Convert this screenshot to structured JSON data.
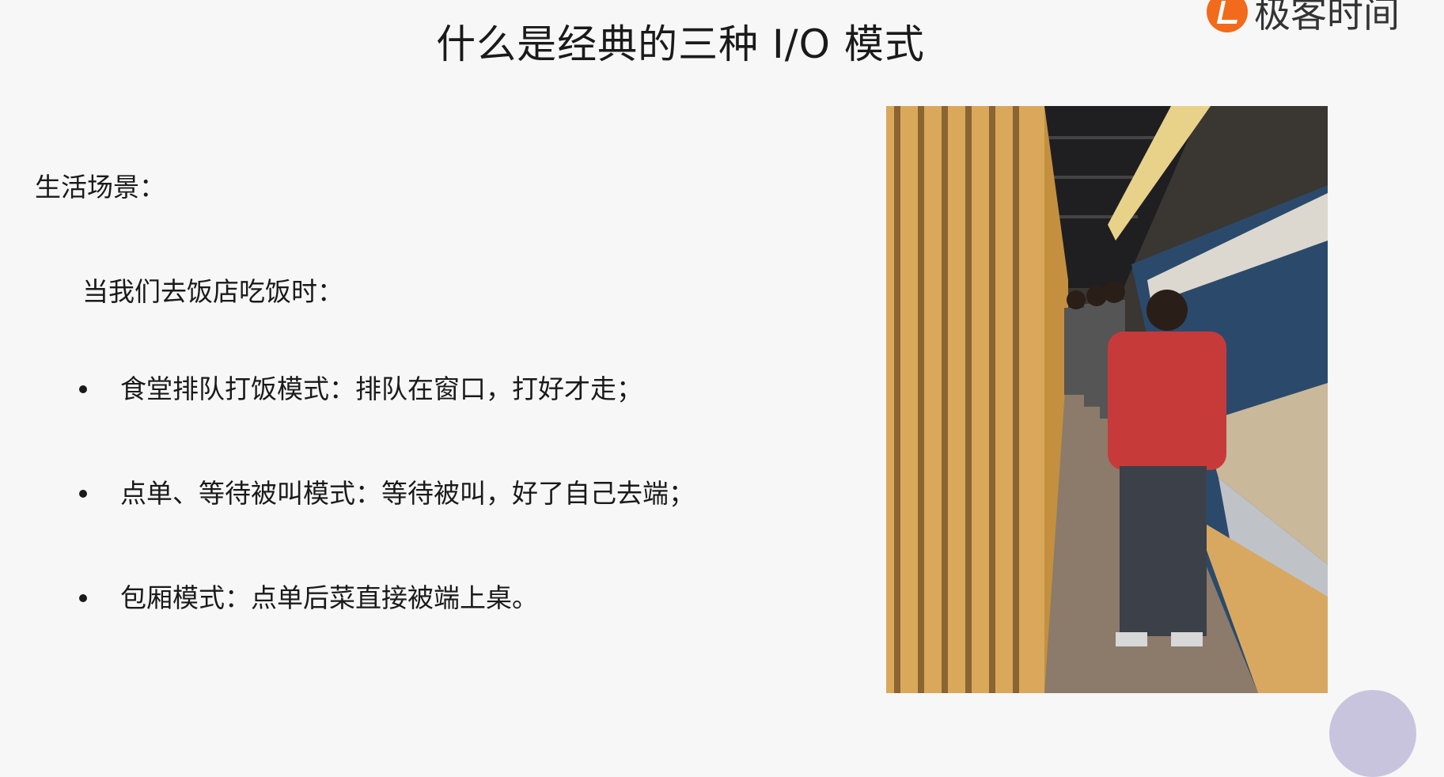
{
  "slide": {
    "title": "什么是经典的三种 I/O 模式",
    "logo_text": "极客时间",
    "section_label": "生活场景：",
    "sub_label": "当我们去饭店吃饭时：",
    "bullets": [
      "食堂排队打饭模式：排队在窗口，打好才走；",
      "点单、等待被叫模式：等待被叫，好了自己去端；",
      "包厢模式：点单后菜直接被端上桌。"
    ]
  },
  "colors": {
    "background": "#f7f7f7",
    "logo_orange": "#f26a1b"
  },
  "photo": {
    "icon": "canteen-queue-photo"
  }
}
